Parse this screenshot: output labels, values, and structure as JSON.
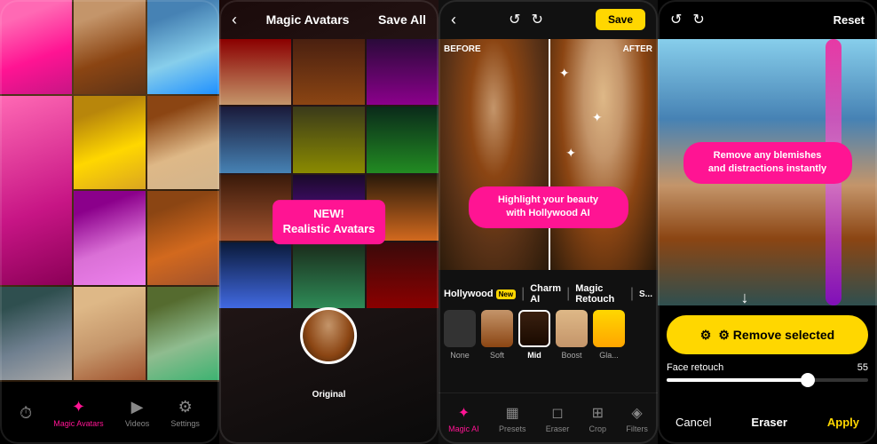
{
  "panels": [
    {
      "id": "panel-magic-avatars",
      "type": "magic-avatars-grid",
      "nav": {
        "items": [
          {
            "label": "",
            "icon": "⏱",
            "active": false,
            "id": "history"
          },
          {
            "label": "Magic Avatars",
            "icon": "✦",
            "active": true,
            "id": "magic-avatars"
          },
          {
            "label": "Videos",
            "icon": "▶",
            "active": false,
            "id": "videos"
          },
          {
            "label": "Settings",
            "icon": "⚙",
            "active": false,
            "id": "settings"
          }
        ]
      }
    },
    {
      "id": "panel-new-realistic",
      "type": "new-avatars",
      "header": {
        "back": "‹",
        "title": "Magic Avatars",
        "save": "Save All"
      },
      "badge": {
        "line1": "NEW!",
        "line2": "Realistic Avatars"
      },
      "original_label": "Original"
    },
    {
      "id": "panel-before-after",
      "type": "before-after-editor",
      "header": {
        "back": "‹",
        "undo": "↺",
        "redo": "↻",
        "save_label": "Save",
        "save_bg": "#FFD700"
      },
      "before_label": "BEFORE",
      "after_label": "AFTER",
      "highlight_bubble": "Highlight your beauty\nwith Hollywood AI",
      "presets": [
        {
          "label": "Hollywood",
          "new": true
        },
        {
          "label": "Charm AI"
        },
        {
          "label": "Magic Retouch"
        },
        {
          "label": "S..."
        }
      ],
      "intensities": [
        {
          "label": "None"
        },
        {
          "label": "Soft"
        },
        {
          "label": "Mid",
          "selected": true
        },
        {
          "label": "Boost"
        },
        {
          "label": "Gla..."
        }
      ],
      "tabs": [
        {
          "label": "Magic AI",
          "icon": "✦",
          "active": true
        },
        {
          "label": "Presets",
          "icon": "▦"
        },
        {
          "label": "Eraser",
          "icon": "◻"
        },
        {
          "label": "Crop",
          "icon": "⊞"
        },
        {
          "label": "Filters",
          "icon": "◈"
        }
      ]
    },
    {
      "id": "panel-blemish-remover",
      "type": "blemish-remover",
      "header": {
        "undo": "↺",
        "redo": "↻",
        "reset": "Reset"
      },
      "blemish_bubble": "Remove any blemishes\nand distractions instantly",
      "remove_button": "⚙ Remove selected",
      "face_retouch": {
        "label": "Face retouch",
        "value": "55"
      },
      "bottom": {
        "cancel": "Cancel",
        "eraser": "Eraser",
        "apply": "Apply"
      }
    }
  ]
}
